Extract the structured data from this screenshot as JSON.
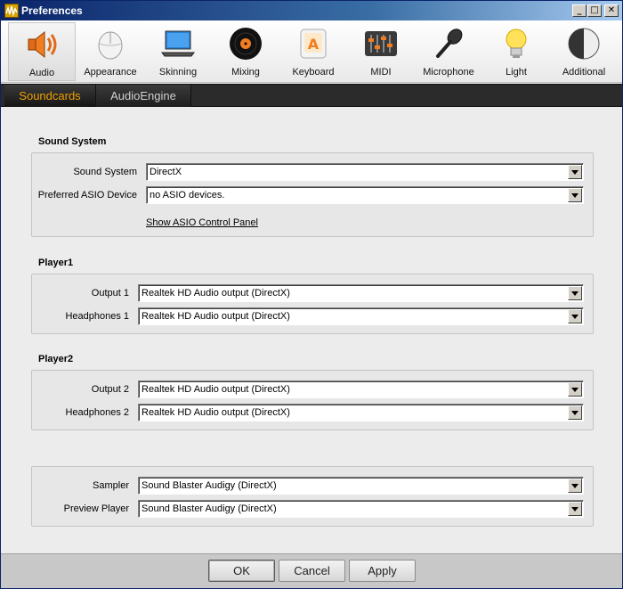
{
  "window": {
    "title": "Preferences",
    "minimize": "_",
    "maximize": "□",
    "close": "✕"
  },
  "toolbar": {
    "items": [
      {
        "label": "Audio",
        "icon": "speaker-icon"
      },
      {
        "label": "Appearance",
        "icon": "mouse-icon"
      },
      {
        "label": "Skinning",
        "icon": "laptop-icon"
      },
      {
        "label": "Mixing",
        "icon": "vinyl-record-icon"
      },
      {
        "label": "Keyboard",
        "icon": "keyboard-key-icon",
        "key_letter": "A"
      },
      {
        "label": "MIDI",
        "icon": "midi-controller-icon"
      },
      {
        "label": "Microphone",
        "icon": "microphone-icon"
      },
      {
        "label": "Light",
        "icon": "light-bulb-icon"
      },
      {
        "label": "Additional",
        "icon": "half-circle-icon"
      }
    ],
    "active": "Audio"
  },
  "tabs": [
    {
      "label": "Soundcards",
      "active": true
    },
    {
      "label": "AudioEngine",
      "active": false
    }
  ],
  "sound_system": {
    "title": "Sound System",
    "sound_system_label": "Sound System",
    "sound_system_value": "DirectX",
    "asio_label": "Preferred ASIO Device",
    "asio_value": "no ASIO devices.",
    "asio_link": "Show ASIO Control Panel"
  },
  "player1": {
    "title": "Player1",
    "output_label": "Output 1",
    "output_value": "Realtek HD Audio output  (DirectX)",
    "headphones_label": "Headphones 1",
    "headphones_value": "Realtek HD Audio output  (DirectX)"
  },
  "player2": {
    "title": "Player2",
    "output_label": "Output 2",
    "output_value": "Realtek HD Audio output  (DirectX)",
    "headphones_label": "Headphones 2",
    "headphones_value": "Realtek HD Audio output  (DirectX)"
  },
  "other": {
    "sampler_label": "Sampler",
    "sampler_value": "Sound Blaster Audigy  (DirectX)",
    "preview_label": "Preview Player",
    "preview_value": "Sound Blaster Audigy  (DirectX)"
  },
  "footer": {
    "ok": "OK",
    "cancel": "Cancel",
    "apply": "Apply"
  },
  "colors": {
    "active_tab": "#f0a000",
    "tab_bar": "#2b2b2b",
    "footer": "#c8c8c8"
  }
}
